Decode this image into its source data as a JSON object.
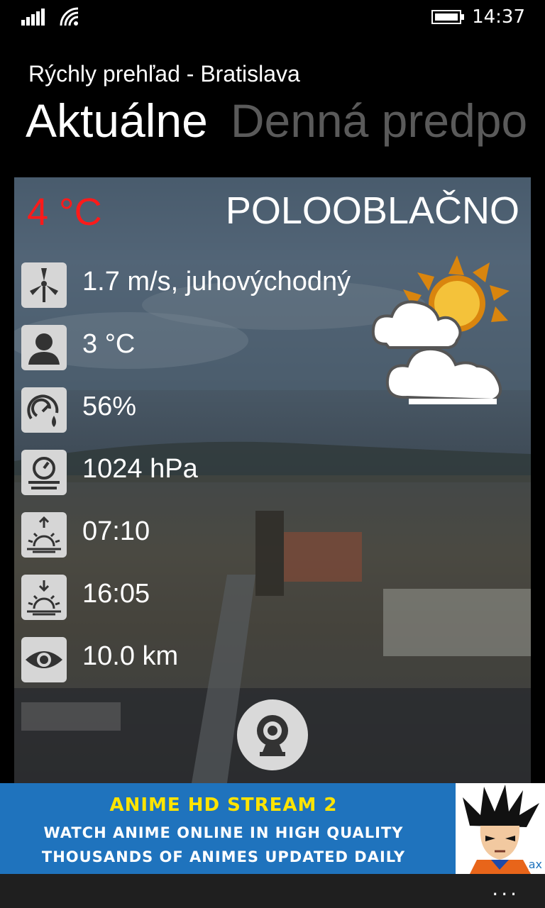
{
  "status_bar": {
    "time": "14:37",
    "signal_icon": "signal-bars-icon",
    "wifi_icon": "wifi-icon",
    "battery_icon": "battery-icon"
  },
  "header": {
    "app_title": "Rýchly prehľad - Bratislava",
    "pivots": [
      {
        "label": "Aktuálne",
        "active": true
      },
      {
        "label": "Denná predpo",
        "active": false
      }
    ]
  },
  "current": {
    "temperature": "4 °C",
    "condition": "POLOOBLAČNO",
    "condition_icon": "partly-cloudy-icon",
    "rows": [
      {
        "icon": "wind-turbine-icon",
        "value": "1.7 m/s, juhovýchodný"
      },
      {
        "icon": "feels-like-person-icon",
        "value": "3 °C"
      },
      {
        "icon": "humidity-gauge-icon",
        "value": "56%"
      },
      {
        "icon": "barometer-icon",
        "value": "1024 hPa"
      },
      {
        "icon": "sunrise-icon",
        "value": "07:10"
      },
      {
        "icon": "sunset-icon",
        "value": "16:05"
      },
      {
        "icon": "visibility-eye-icon",
        "value": "10.0 km"
      }
    ],
    "webcam_icon": "webcam-icon"
  },
  "ad": {
    "title": "ANIME HD STREAM 2",
    "line1": "WATCH ANIME ONLINE IN HIGH QUALITY",
    "line2": "THOUSANDS OF ANIMES UPDATED DAILY",
    "badge": "ax"
  },
  "appbar": {
    "more": "..."
  },
  "colors": {
    "temperature": "#ff1a1a",
    "inactive_pivot": "#5a5a5a",
    "ad_background": "#1f73bd",
    "ad_title": "#ffe400"
  }
}
